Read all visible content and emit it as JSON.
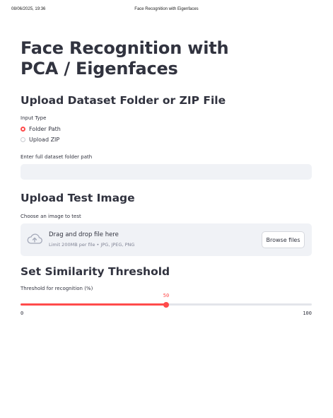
{
  "print_header": {
    "date": "08/06/2025, 19:36",
    "title": "Face Recognition with Eigenfaces"
  },
  "page": {
    "title": "Face Recognition with PCA / Eigenfaces"
  },
  "dataset_section": {
    "heading": "Upload Dataset Folder or ZIP File",
    "input_type_label": "Input Type",
    "options": [
      {
        "label": "Folder Path",
        "selected": true
      },
      {
        "label": "Upload ZIP",
        "selected": false
      }
    ],
    "path_label": "Enter full dataset folder path",
    "path_value": ""
  },
  "test_image_section": {
    "heading": "Upload Test Image",
    "label": "Choose an image to test",
    "drop_title": "Drag and drop file here",
    "drop_subtitle": "Limit 200MB per file • JPG, JPEG, PNG",
    "browse_label": "Browse files",
    "icon": "cloud-upload-icon"
  },
  "threshold_section": {
    "heading": "Set Similarity Threshold",
    "label": "Threshold for recognition (%)",
    "value": 50,
    "value_text": "50",
    "min": 0,
    "max": 100,
    "min_text": "0",
    "max_text": "100"
  },
  "colors": {
    "accent": "#ff4b4b",
    "input_bg": "#f0f2f6",
    "text": "#31333f",
    "muted": "#808495"
  }
}
